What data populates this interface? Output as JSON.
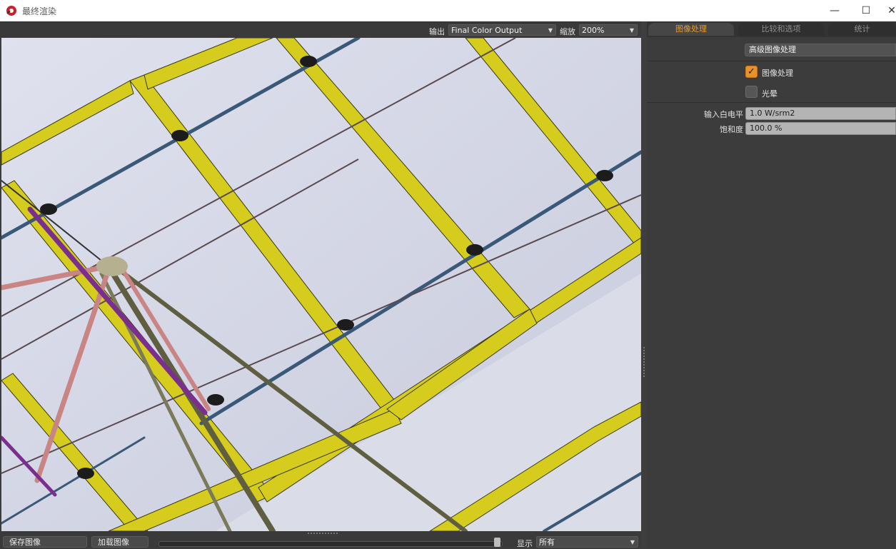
{
  "window": {
    "title": "最终渲染",
    "minimize_glyph": "—",
    "maximize_glyph": "☐",
    "close_glyph": "✕"
  },
  "viewport_toolbar": {
    "output_label": "输出",
    "output_value": "Final Color Output",
    "zoom_label": "缩放",
    "zoom_value": "200%"
  },
  "viewport_bottom": {
    "save_button": "保存图像",
    "load_button": "加载图像",
    "show_label": "显示",
    "show_value": "所有"
  },
  "tabs": [
    {
      "label": "图像处理",
      "active": true
    },
    {
      "label": "比较和选项",
      "active": false
    },
    {
      "label": "统计",
      "active": false
    }
  ],
  "panel": {
    "advanced_button": "高级图像处理",
    "image_processing": {
      "label": "图像处理",
      "checked": true
    },
    "bloom": {
      "label": "光晕",
      "checked": false
    },
    "input_white_label": "输入白电平",
    "input_white_value": "1.0 W/srm2",
    "saturation_label": "饱和度",
    "saturation_value": "100.0 %"
  },
  "colors": {
    "accent": "#e8922a",
    "panel_bg": "#3c3c3c",
    "frame_yellow": "#d8cf1c",
    "glass": "#d0d3e1"
  }
}
